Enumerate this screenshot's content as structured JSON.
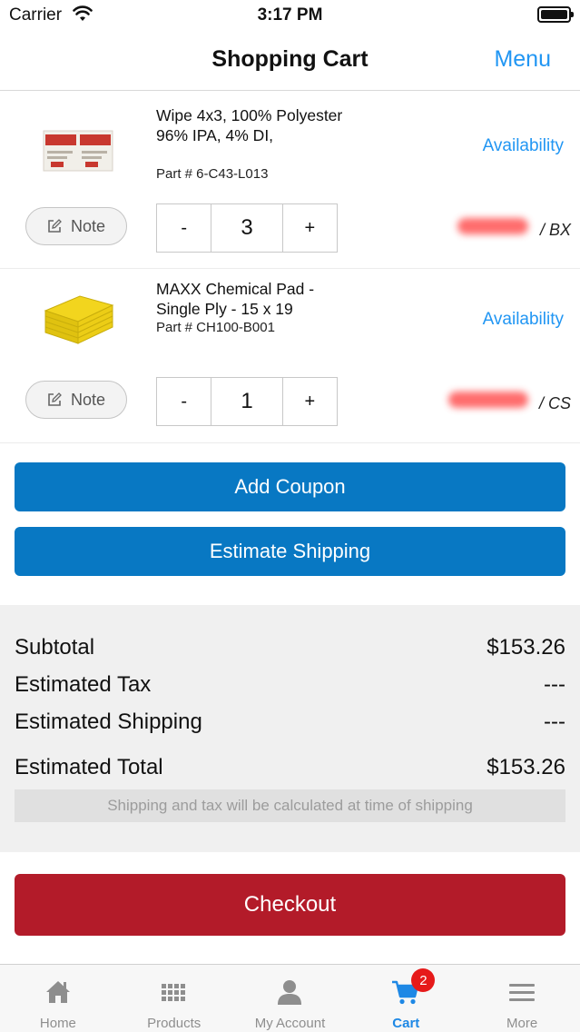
{
  "status_bar": {
    "carrier": "Carrier",
    "time": "3:17 PM"
  },
  "header": {
    "title": "Shopping Cart",
    "menu_label": "Menu"
  },
  "items": [
    {
      "title": "Wipe 4x3, 100% Polyester 96% IPA, 4% DI,",
      "part": "Part # 6-C43-L013",
      "availability_label": "Availability",
      "note_label": "Note",
      "minus_label": "-",
      "quantity": "3",
      "plus_label": "+",
      "unit": "/ BX",
      "thumbnail_icon": "wipe-packet-thumbnail"
    },
    {
      "title": "MAXX Chemical Pad - Single Ply - 15 x 19",
      "part": "Part # CH100-B001",
      "availability_label": "Availability",
      "note_label": "Note",
      "minus_label": "-",
      "quantity": "1",
      "plus_label": "+",
      "unit": "/ CS",
      "thumbnail_icon": "yellow-pad-stack-thumbnail"
    }
  ],
  "buttons": {
    "add_coupon": "Add Coupon",
    "estimate_shipping": "Estimate Shipping",
    "checkout": "Checkout"
  },
  "summary": {
    "subtotal_label": "Subtotal",
    "subtotal_value": "$153.26",
    "tax_label": "Estimated Tax",
    "tax_value": "---",
    "shipping_label": "Estimated Shipping",
    "shipping_value": "---",
    "total_label": "Estimated Total",
    "total_value": "$153.26",
    "note": "Shipping and tax will be calculated at time of shipping"
  },
  "tabs": [
    {
      "label": "Home",
      "icon": "home-icon"
    },
    {
      "label": "Products",
      "icon": "grid-icon"
    },
    {
      "label": "My Account",
      "icon": "person-icon"
    },
    {
      "label": "Cart",
      "icon": "cart-icon",
      "badge": "2",
      "active": true
    },
    {
      "label": "More",
      "icon": "hamburger-icon"
    }
  ],
  "colors": {
    "accent": "#2196f3",
    "primary_button": "#0878c3",
    "checkout": "#b31b29",
    "badge": "#e61a1a"
  }
}
